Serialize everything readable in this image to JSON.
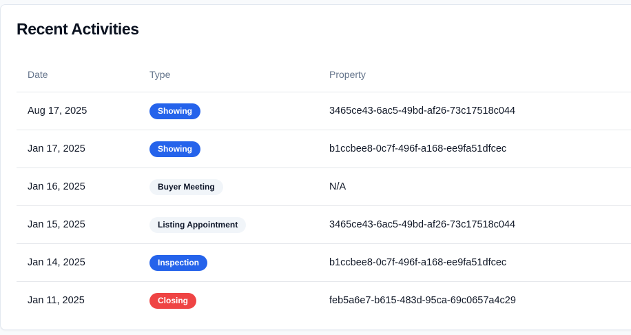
{
  "card": {
    "title": "Recent Activities"
  },
  "table": {
    "columns": [
      "Date",
      "Type",
      "Property"
    ],
    "rows": [
      {
        "date": "Aug 17, 2025",
        "type": "Showing",
        "type_color": "#2563eb",
        "property": "3465ce43-6ac5-49bd-af26-73c17518c044"
      },
      {
        "date": "Jan 17, 2025",
        "type": "Showing",
        "type_color": "#2563eb",
        "property": "b1ccbee8-0c7f-496f-a168-ee9fa51dfcec"
      },
      {
        "date": "Jan 16, 2025",
        "type": "Buyer Meeting",
        "type_color": "#f1f5f9",
        "property": "N/A"
      },
      {
        "date": "Jan 15, 2025",
        "type": "Listing Appointment",
        "type_color": "#f1f5f9",
        "property": "3465ce43-6ac5-49bd-af26-73c17518c044"
      },
      {
        "date": "Jan 14, 2025",
        "type": "Inspection",
        "type_color": "#2563eb",
        "property": "b1ccbee8-0c7f-496f-a168-ee9fa51dfcec"
      },
      {
        "date": "Jan 11, 2025",
        "type": "Closing",
        "type_color": "#ef4444",
        "property": "feb5a6e7-b615-483d-95ca-69c0657a4c29"
      }
    ]
  }
}
